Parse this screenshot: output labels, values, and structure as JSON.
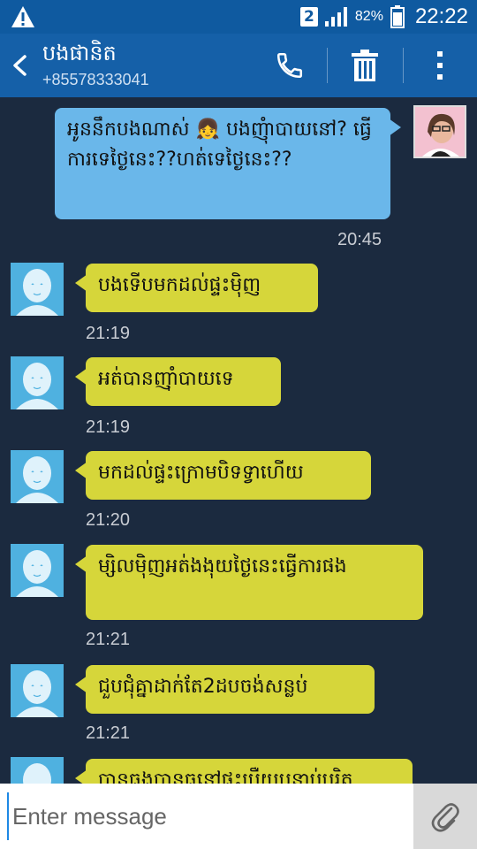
{
  "status_bar": {
    "sim_slot": "2",
    "battery_percent": "82%",
    "time": "22:22"
  },
  "header": {
    "contact_name": "បងផានិត",
    "contact_number": "+85578333041"
  },
  "messages": [
    {
      "direction": "outgoing",
      "text": "អូននឹកបងណាស់ 👧 បងញុំាបាយនៅ? ធ្វើការទេថ្ងៃនេះ??ហត់ទេថ្ងៃនេះ??",
      "time": "20:45"
    },
    {
      "direction": "incoming",
      "text": "បងទើបមកដល់ផ្ទះម៉ិញ",
      "time": "21:19"
    },
    {
      "direction": "incoming",
      "text": "អត់បានញ៉ាំបាយទេ",
      "time": "21:19"
    },
    {
      "direction": "incoming",
      "text": "មកដល់ផ្ទះក្រោមបិទទ្វាហើយ",
      "time": "21:20"
    },
    {
      "direction": "incoming",
      "text": "ម្សិលម៉ិញអត់ងងុយថ្ងៃនេះធ្វើការផង",
      "time": "21:21"
    },
    {
      "direction": "incoming",
      "text": "ជួបជុំគ្នាដាក់តែ2ដបចង់សន្លប់",
      "time": "21:21"
    },
    {
      "direction": "incoming",
      "text": "បានធ្វងបានធ្វនៅផ្ទះប្រឺយបន្ទាប់បរិត"
    }
  ],
  "input": {
    "placeholder": "Enter message"
  },
  "colors": {
    "status_bar": "#0f5aa0",
    "header": "#1560a8",
    "background": "#1b2a3f",
    "outgoing_bubble": "#6ab7ea",
    "incoming_bubble": "#d6d63a"
  }
}
